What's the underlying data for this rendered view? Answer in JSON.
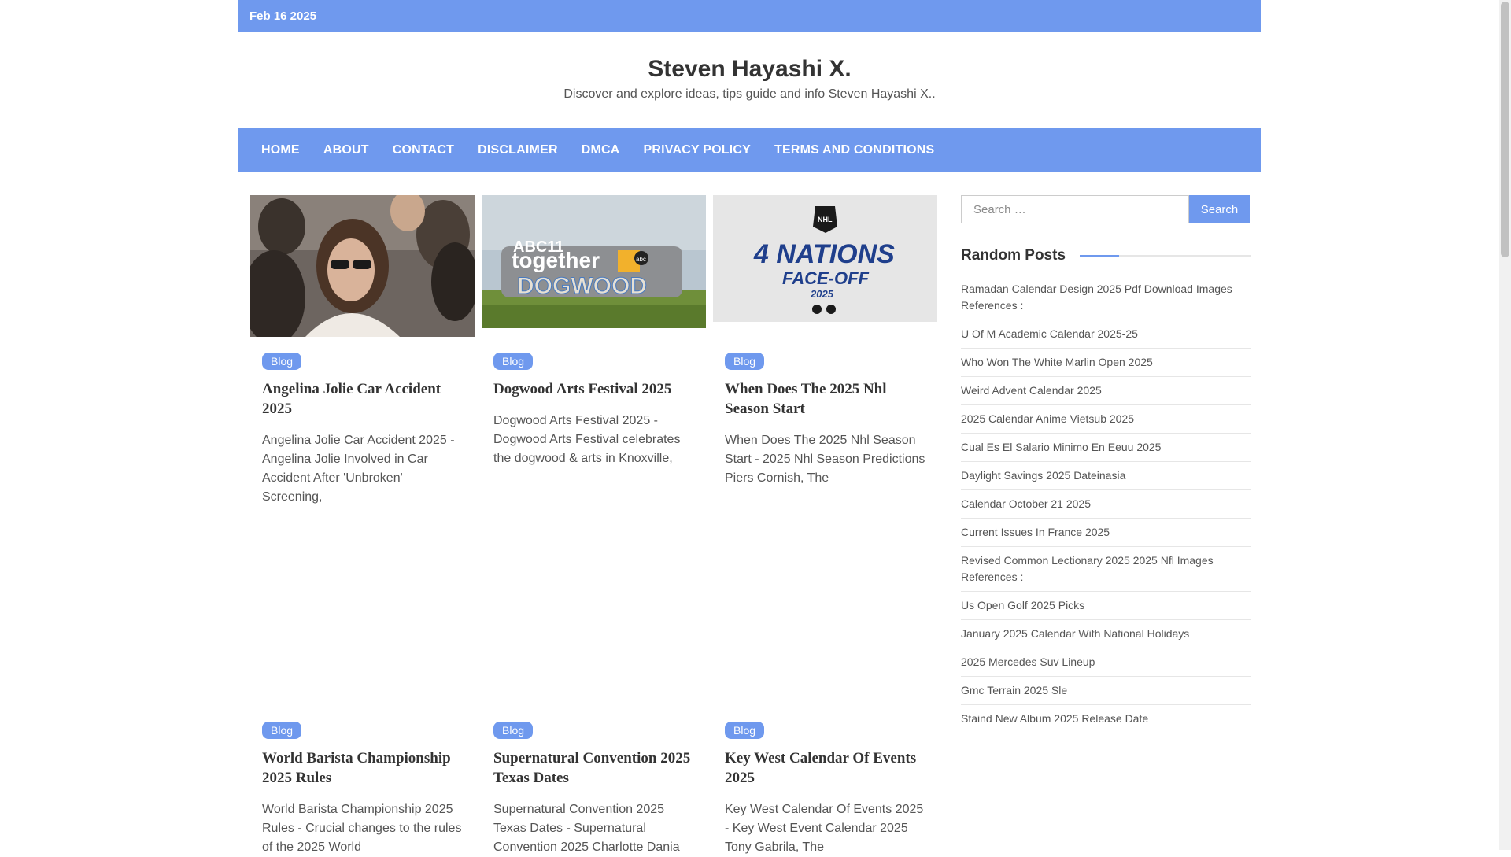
{
  "topbar": {
    "date": "Feb 16 2025"
  },
  "header": {
    "title": "Steven Hayashi X.",
    "description": "Discover and explore ideas, tips guide and info Steven Hayashi X.."
  },
  "nav": {
    "items": [
      "HOME",
      "ABOUT",
      "CONTACT",
      "DISCLAIMER",
      "DMCA",
      "PRIVACY POLICY",
      "TERMS AND CONDITIONS"
    ]
  },
  "colors": {
    "accent": "#6f99ee",
    "text": "#333333",
    "muted": "#555555"
  },
  "posts": [
    {
      "category": "Blog",
      "title": "Angelina Jolie Car Accident 2025",
      "excerpt": "Angelina Jolie Car Accident 2025 - Angelina Jolie Involved in Car Accident After 'Unbroken' Screening,",
      "image": "photo-woman-sunglasses-crowd"
    },
    {
      "category": "Blog",
      "title": "Dogwood Arts Festival 2025",
      "excerpt": "Dogwood Arts Festival 2025 - Dogwood Arts Festival celebrates the dogwood & arts in Knoxville,",
      "image": "abc11-together-dogwood-sign",
      "image_text": {
        "line1": "ABC11",
        "line2": "together",
        "line3": "DOGWOOD",
        "logo": "abc"
      }
    },
    {
      "category": "Blog",
      "title": "When Does The 2025 Nhl Season Start",
      "excerpt": "When Does The 2025 Nhl Season Start - 2025 Nhl Season Predictions Piers Cornish, The",
      "image": "nhl-4-nations-face-off-logo",
      "image_text": {
        "top": "NHL",
        "main": "4 NATIONS",
        "sub": "FACE-OFF",
        "year": "2025"
      }
    },
    {
      "category": "Blog",
      "title": "World Barista Championship 2025 Rules",
      "excerpt": "World Barista Championship 2025 Rules - Crucial changes to the rules of the 2025 World"
    },
    {
      "category": "Blog",
      "title": "Supernatural Convention 2025 Texas Dates",
      "excerpt": "Supernatural Convention 2025 Texas Dates - Supernatural Convention 2025 Charlotte Dania"
    },
    {
      "category": "Blog",
      "title": "Key West Calendar Of Events 2025",
      "excerpt": "Key West Calendar Of Events 2025 - Key West Event Calendar 2025 Tony Gabrila, The"
    }
  ],
  "sidebar": {
    "search_placeholder": "Search …",
    "search_button": "Search",
    "random_title": "Random Posts",
    "random_posts": [
      "Ramadan Calendar Design 2025 Pdf Download Images References :",
      "U Of M Academic Calendar 2025-25",
      "Who Won The White Marlin Open 2025",
      "Weird Advent Calendar 2025",
      "2025 Calendar Anime Vietsub 2025",
      "Cual Es El Salario Minimo En Eeuu 2025",
      "Daylight Savings 2025 Dateinasia",
      "Calendar October 21 2025",
      "Current Issues In France 2025",
      "Revised Common Lectionary 2025 2025 Nfl Images References :",
      "Us Open Golf 2025 Picks",
      "January 2025 Calendar With National Holidays",
      "2025 Mercedes Suv Lineup",
      "Gmc Terrain 2025 Sle",
      "Staind New Album 2025 Release Date"
    ]
  }
}
